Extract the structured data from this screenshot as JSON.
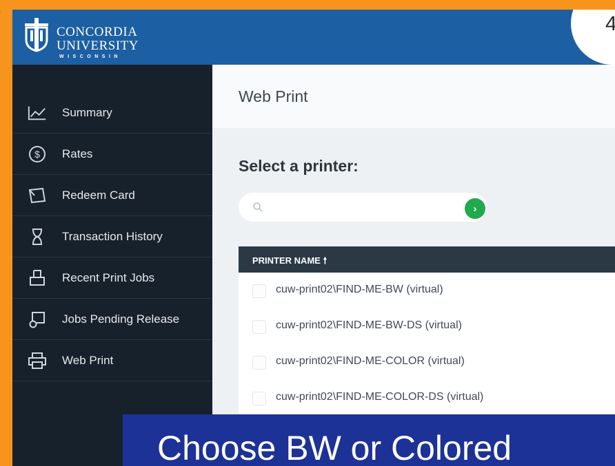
{
  "brand": {
    "line1": "CONCORDIA",
    "line2": "UNIVERSITY",
    "line3": "WISCONSIN"
  },
  "step_badge": "4",
  "sidebar": {
    "items": [
      {
        "label": "Summary",
        "icon": "chart-line-icon"
      },
      {
        "label": "Rates",
        "icon": "dollar-circle-icon"
      },
      {
        "label": "Redeem Card",
        "icon": "card-icon"
      },
      {
        "label": "Transaction History",
        "icon": "hourglass-icon"
      },
      {
        "label": "Recent Print Jobs",
        "icon": "tray-icon"
      },
      {
        "label": "Jobs Pending Release",
        "icon": "pending-release-icon"
      },
      {
        "label": "Web Print",
        "icon": "printer-icon"
      }
    ]
  },
  "main": {
    "title": "Web Print",
    "heading": "Select a printer:",
    "search_placeholder": "",
    "go_label": "›",
    "table": {
      "header": "PRINTER NAME",
      "rows": [
        "cuw-print02\\FIND-ME-BW (virtual)",
        "cuw-print02\\FIND-ME-BW-DS (virtual)",
        "cuw-print02\\FIND-ME-COLOR (virtual)",
        "cuw-print02\\FIND-ME-COLOR-DS (virtual)"
      ]
    }
  },
  "caption": "Choose BW or Colored",
  "colors": {
    "frame": "#f7941d",
    "topbar": "#1c5fa3",
    "sidebar": "#17212c",
    "go": "#1eaa4d",
    "caption": "#1d3296"
  }
}
